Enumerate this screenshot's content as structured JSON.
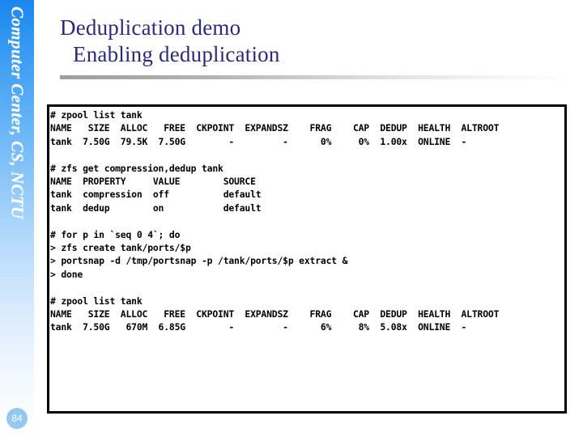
{
  "sidebar": {
    "brand_text": "Computer Center, CS, NCTU",
    "page_number": "84"
  },
  "slide": {
    "title_line1": "Deduplication demo",
    "title_line2": "Enabling deduplication"
  },
  "terminal": {
    "blocks": [
      {
        "name": "zpool-list-before",
        "lines": [
          "# zpool list tank",
          "NAME   SIZE  ALLOC   FREE  CKPOINT  EXPANDSZ    FRAG    CAP  DEDUP  HEALTH  ALTROOT",
          "tank  7.50G  79.5K  7.50G        -         -      0%     0%  1.00x  ONLINE  -"
        ]
      },
      {
        "name": "zfs-get-properties",
        "lines": [
          "# zfs get compression,dedup tank",
          "NAME  PROPERTY     VALUE        SOURCE",
          "tank  compression  off          default",
          "tank  dedup        on           default"
        ]
      },
      {
        "name": "extract-ports-loop",
        "lines": [
          "# for p in `seq 0 4`; do",
          "> zfs create tank/ports/$p",
          "> portsnap -d /tmp/portsnap -p /tank/ports/$p extract &",
          "> done"
        ]
      },
      {
        "name": "zpool-list-after",
        "lines": [
          "# zpool list tank",
          "NAME   SIZE  ALLOC   FREE  CKPOINT  EXPANDSZ    FRAG    CAP  DEDUP  HEALTH  ALTROOT",
          "tank  7.50G   670M  6.85G        -         -      6%     8%  5.08x  ONLINE  -"
        ]
      }
    ]
  },
  "colors": {
    "title": "#2a2a7a",
    "sidebar_top": "#1a86ee",
    "badge": "#93c8f0",
    "terminal_border": "#000000"
  }
}
